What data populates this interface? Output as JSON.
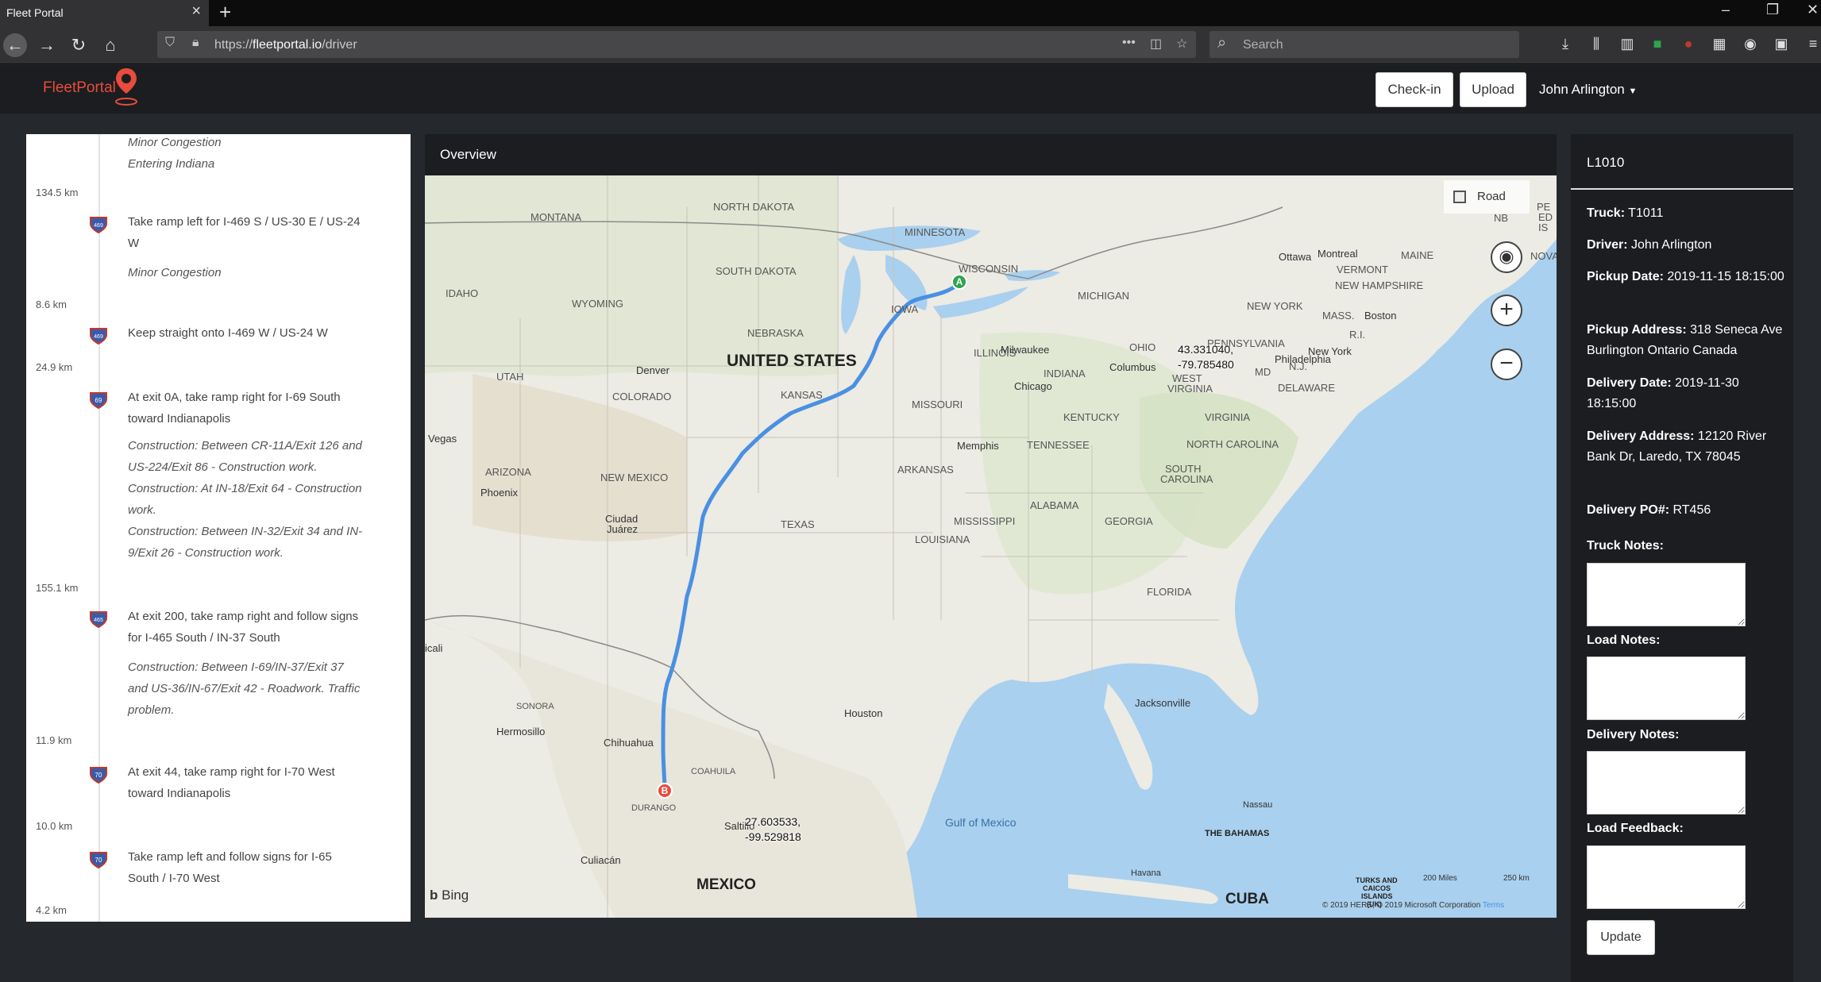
{
  "browser": {
    "tab_title": "Fleet Portal",
    "url_prefix": "https://",
    "url_host": "fleetportal.io",
    "url_path": "/driver",
    "search_placeholder": "Search"
  },
  "header": {
    "logo": "FleetPortal",
    "checkin_label": "Check-in",
    "upload_label": "Upload",
    "user_name": "John Arlington"
  },
  "directions": [
    {
      "type": "note",
      "text": "Minor Congestion"
    },
    {
      "type": "note",
      "text": "Entering Indiana"
    },
    {
      "type": "dist",
      "text": "134.5 km"
    },
    {
      "type": "step",
      "shield": "469",
      "text": "Take ramp left for I-469 S / US-30 E / US-24 W"
    },
    {
      "type": "note",
      "text": "Minor Congestion"
    },
    {
      "type": "dist",
      "text": "8.6 km"
    },
    {
      "type": "step",
      "shield": "469",
      "text": "Keep straight onto I-469 W / US-24 W"
    },
    {
      "type": "dist",
      "text": "24.9 km"
    },
    {
      "type": "step",
      "shield": "69",
      "text": "At exit 0A, take ramp right for I-69 South toward Indianapolis"
    },
    {
      "type": "note",
      "text": "Construction: Between CR-11A/Exit 126 and US-224/Exit 86 - Construction work."
    },
    {
      "type": "note",
      "text": "Construction: At IN-18/Exit 64 - Construction work."
    },
    {
      "type": "note",
      "text": "Construction: Between IN-32/Exit 34 and IN-9/Exit 26 - Construction work."
    },
    {
      "type": "dist",
      "text": "155.1 km"
    },
    {
      "type": "step",
      "shield": "465",
      "text": "At exit 200, take ramp right and follow signs for I-465 South / IN-37 South"
    },
    {
      "type": "note",
      "text": "Construction: Between I-69/IN-37/Exit 37 and US-36/IN-67/Exit 42 - Roadwork. Traffic problem."
    },
    {
      "type": "dist",
      "text": "11.9 km"
    },
    {
      "type": "step",
      "shield": "70",
      "text": "At exit 44, take ramp right for I-70 West toward Indianapolis"
    },
    {
      "type": "dist",
      "text": "10.0 km"
    },
    {
      "type": "step",
      "shield": "70",
      "text": "Take ramp left and follow signs for I-65 South / I-70 West"
    },
    {
      "type": "dist",
      "text": "4.2 km"
    }
  ],
  "map": {
    "title": "Overview",
    "road_label": "Road",
    "start_marker": "A",
    "end_marker": "B",
    "start_coord_1": "43.331040,",
    "start_coord_2": "-79.785480",
    "end_coord_1": "27.603533,",
    "end_coord_2": "-99.529818",
    "bing_label": "Bing",
    "copyright": "© 2019 HERE, © 2019 Microsoft Corporation",
    "terms": "Terms",
    "scale_miles": "200 Miles",
    "scale_km": "250 km",
    "route_color": "#4a90e2",
    "labels": {
      "montana": "MONTANA",
      "north_dakota": "NORTH DAKOTA",
      "minnesota": "MINNESOTA",
      "south_dakota": "SOUTH DAKOTA",
      "wisconsin": "WISCONSIN",
      "michigan": "MICHIGAN",
      "idaho": "IDAHO",
      "wyoming": "WYOMING",
      "iowa": "IOWA",
      "nebraska": "NEBRASKA",
      "illinois": "ILLINOIS",
      "ohio": "OHIO",
      "indiana": "INDIANA",
      "utah": "UTAH",
      "colorado": "COLORADO",
      "kansas": "KANSAS",
      "missouri": "MISSOURI",
      "kentucky": "KENTUCKY",
      "tennessee": "TENNESSEE",
      "arizona": "ARIZONA",
      "new_mexico": "NEW MEXICO",
      "texas": "TEXAS",
      "arkansas": "ARKANSAS",
      "mississippi": "MISSISSIPPI",
      "alabama": "ALABAMA",
      "georgia": "GEORGIA",
      "louisiana": "LOUISIANA",
      "florida": "FLORIDA",
      "north_carolina": "NORTH CAROLINA",
      "south_carolina_1": "SOUTH",
      "south_carolina_2": "CAROLINA",
      "virginia": "VIRGINIA",
      "west_virginia_1": "WEST",
      "west_virginia_2": "VIRGINIA",
      "pennsylvania": "PENNSYLVANIA",
      "new_york": "NEW YORK",
      "vermont": "VERMONT",
      "maine": "MAINE",
      "new_hampshire": "NEW HAMPSHIRE",
      "mass": "MASS.",
      "md": "MD",
      "nj": "N.J.",
      "ri": "R.I.",
      "delaware": "DELAWARE",
      "nb": "NB",
      "nova": "NOVA",
      "pe": "PE",
      "ed": "ED",
      "is": "IS",
      "united_states": "UNITED STATES",
      "mexico": "MEXICO",
      "cuba": "CUBA",
      "the_bahamas": "THE BAHAMAS",
      "turks_1": "TURKS AND",
      "turks_2": "CAICOS",
      "turks_3": "ISLANDS",
      "turks_4": "(UK)",
      "sonora": "SONORA",
      "coahuila": "COAHUILA",
      "durango": "DURANGO",
      "milwaukee": "Milwaukee",
      "chicago": "Chicago",
      "ottawa": "Ottawa",
      "montreal": "Montreal",
      "boston": "Boston",
      "new_york_city": "New York",
      "philadelphia": "Philadelphia",
      "columbus": "Columbus",
      "denver": "Denver",
      "vegas": "Vegas",
      "phoenix": "Phoenix",
      "ciudad_1": "Ciudad",
      "ciudad_2": "Juárez",
      "memphis": "Memphis",
      "houston": "Houston",
      "jacksonville": "Jacksonville",
      "chihuahua": "Chihuahua",
      "hermosillo": "Hermosillo",
      "saltillo": "Saltillo",
      "culiacan": "Culiacán",
      "nassau": "Nassau",
      "havana": "Havana",
      "icali": "icali",
      "gulf_of_mexico": "Gulf of Mexico"
    }
  },
  "details": {
    "load_id": "L1010",
    "truck_label": "Truck:",
    "truck_value": "T1011",
    "driver_label": "Driver:",
    "driver_value": "John Arlington",
    "pickup_date_label": "Pickup Date:",
    "pickup_date_value": "2019-11-15 18:15:00",
    "pickup_address_label": "Pickup Address:",
    "pickup_address_value": "318 Seneca Ave Burlington Ontario Canada",
    "delivery_date_label": "Delivery Date:",
    "delivery_date_value": "2019-11-30 18:15:00",
    "delivery_address_label": "Delivery Address:",
    "delivery_address_value": "12120 River Bank Dr, Laredo, TX 78045",
    "delivery_po_label": "Delivery PO#:",
    "delivery_po_value": "RT456",
    "truck_notes_label": "Truck Notes:",
    "load_notes_label": "Load Notes:",
    "delivery_notes_label": "Delivery Notes:",
    "load_feedback_label": "Load Feedback:",
    "update_label": "Update"
  }
}
